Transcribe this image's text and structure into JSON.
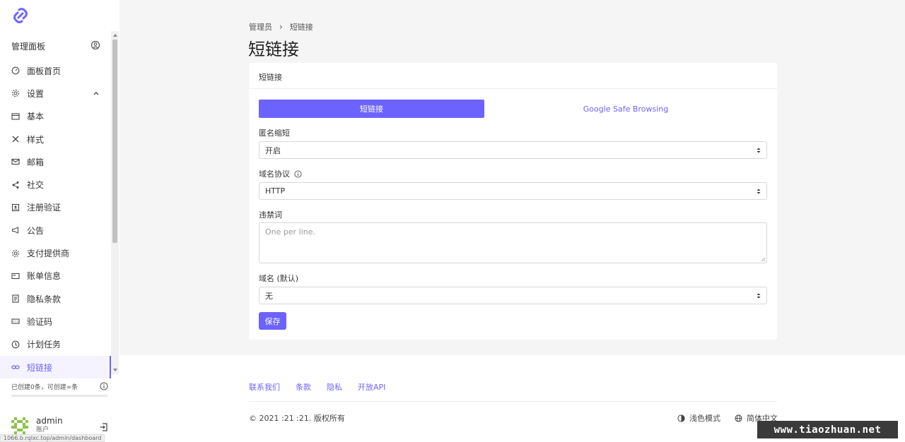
{
  "sidebar": {
    "panel_title": "管理面板",
    "items": [
      {
        "label": "面板首页",
        "icon": "dashboard-icon"
      },
      {
        "label": "设置",
        "icon": "gear-icon"
      },
      {
        "label": "基本",
        "icon": "window-icon"
      },
      {
        "label": "样式",
        "icon": "tools-icon"
      },
      {
        "label": "邮箱",
        "icon": "mail-icon"
      },
      {
        "label": "社交",
        "icon": "share-icon"
      },
      {
        "label": "注册验证",
        "icon": "id-card-icon"
      },
      {
        "label": "公告",
        "icon": "megaphone-icon"
      },
      {
        "label": "支付提供商",
        "icon": "cog-icon"
      },
      {
        "label": "账单信息",
        "icon": "credit-card-icon"
      },
      {
        "label": "隐私条款",
        "icon": "document-icon"
      },
      {
        "label": "验证码",
        "icon": "captcha-icon"
      },
      {
        "label": "计划任务",
        "icon": "clock-icon"
      },
      {
        "label": "短链接",
        "icon": "link-icon",
        "active": true
      }
    ],
    "quota_text": "已创建0条，可创建∞条",
    "quota_fraction": 0,
    "user": {
      "name": "admin",
      "role": "账户"
    },
    "status_url": "1066.b.rqlxc.top/admin/dashboard"
  },
  "breadcrumb": {
    "parent": "管理员",
    "current": "短链接"
  },
  "page_title": "短链接",
  "card": {
    "header": "短链接",
    "tabs": [
      {
        "label": "短链接",
        "active": true
      },
      {
        "label": "Google Safe Browsing",
        "active": false
      }
    ],
    "fields": {
      "anonymous": {
        "label": "匿名缩短",
        "value": "开启"
      },
      "protocol": {
        "label": "域名协议",
        "value": "HTTP"
      },
      "banned": {
        "label": "违禁词",
        "placeholder": "One per line."
      },
      "domain": {
        "label": "域名 (默认)",
        "value": "无"
      }
    },
    "save_label": "保存"
  },
  "footer": {
    "links": [
      "联系我们",
      "条款",
      "隐私",
      "开放API"
    ],
    "copyright": "© 2021 :21 :21. 版权所有",
    "theme_label": "浅色模式",
    "language_label": "简体中文"
  },
  "watermark": "www.tiaozhuan.net",
  "colors": {
    "accent": "#6c63ff",
    "background": "#f5f5f5"
  }
}
